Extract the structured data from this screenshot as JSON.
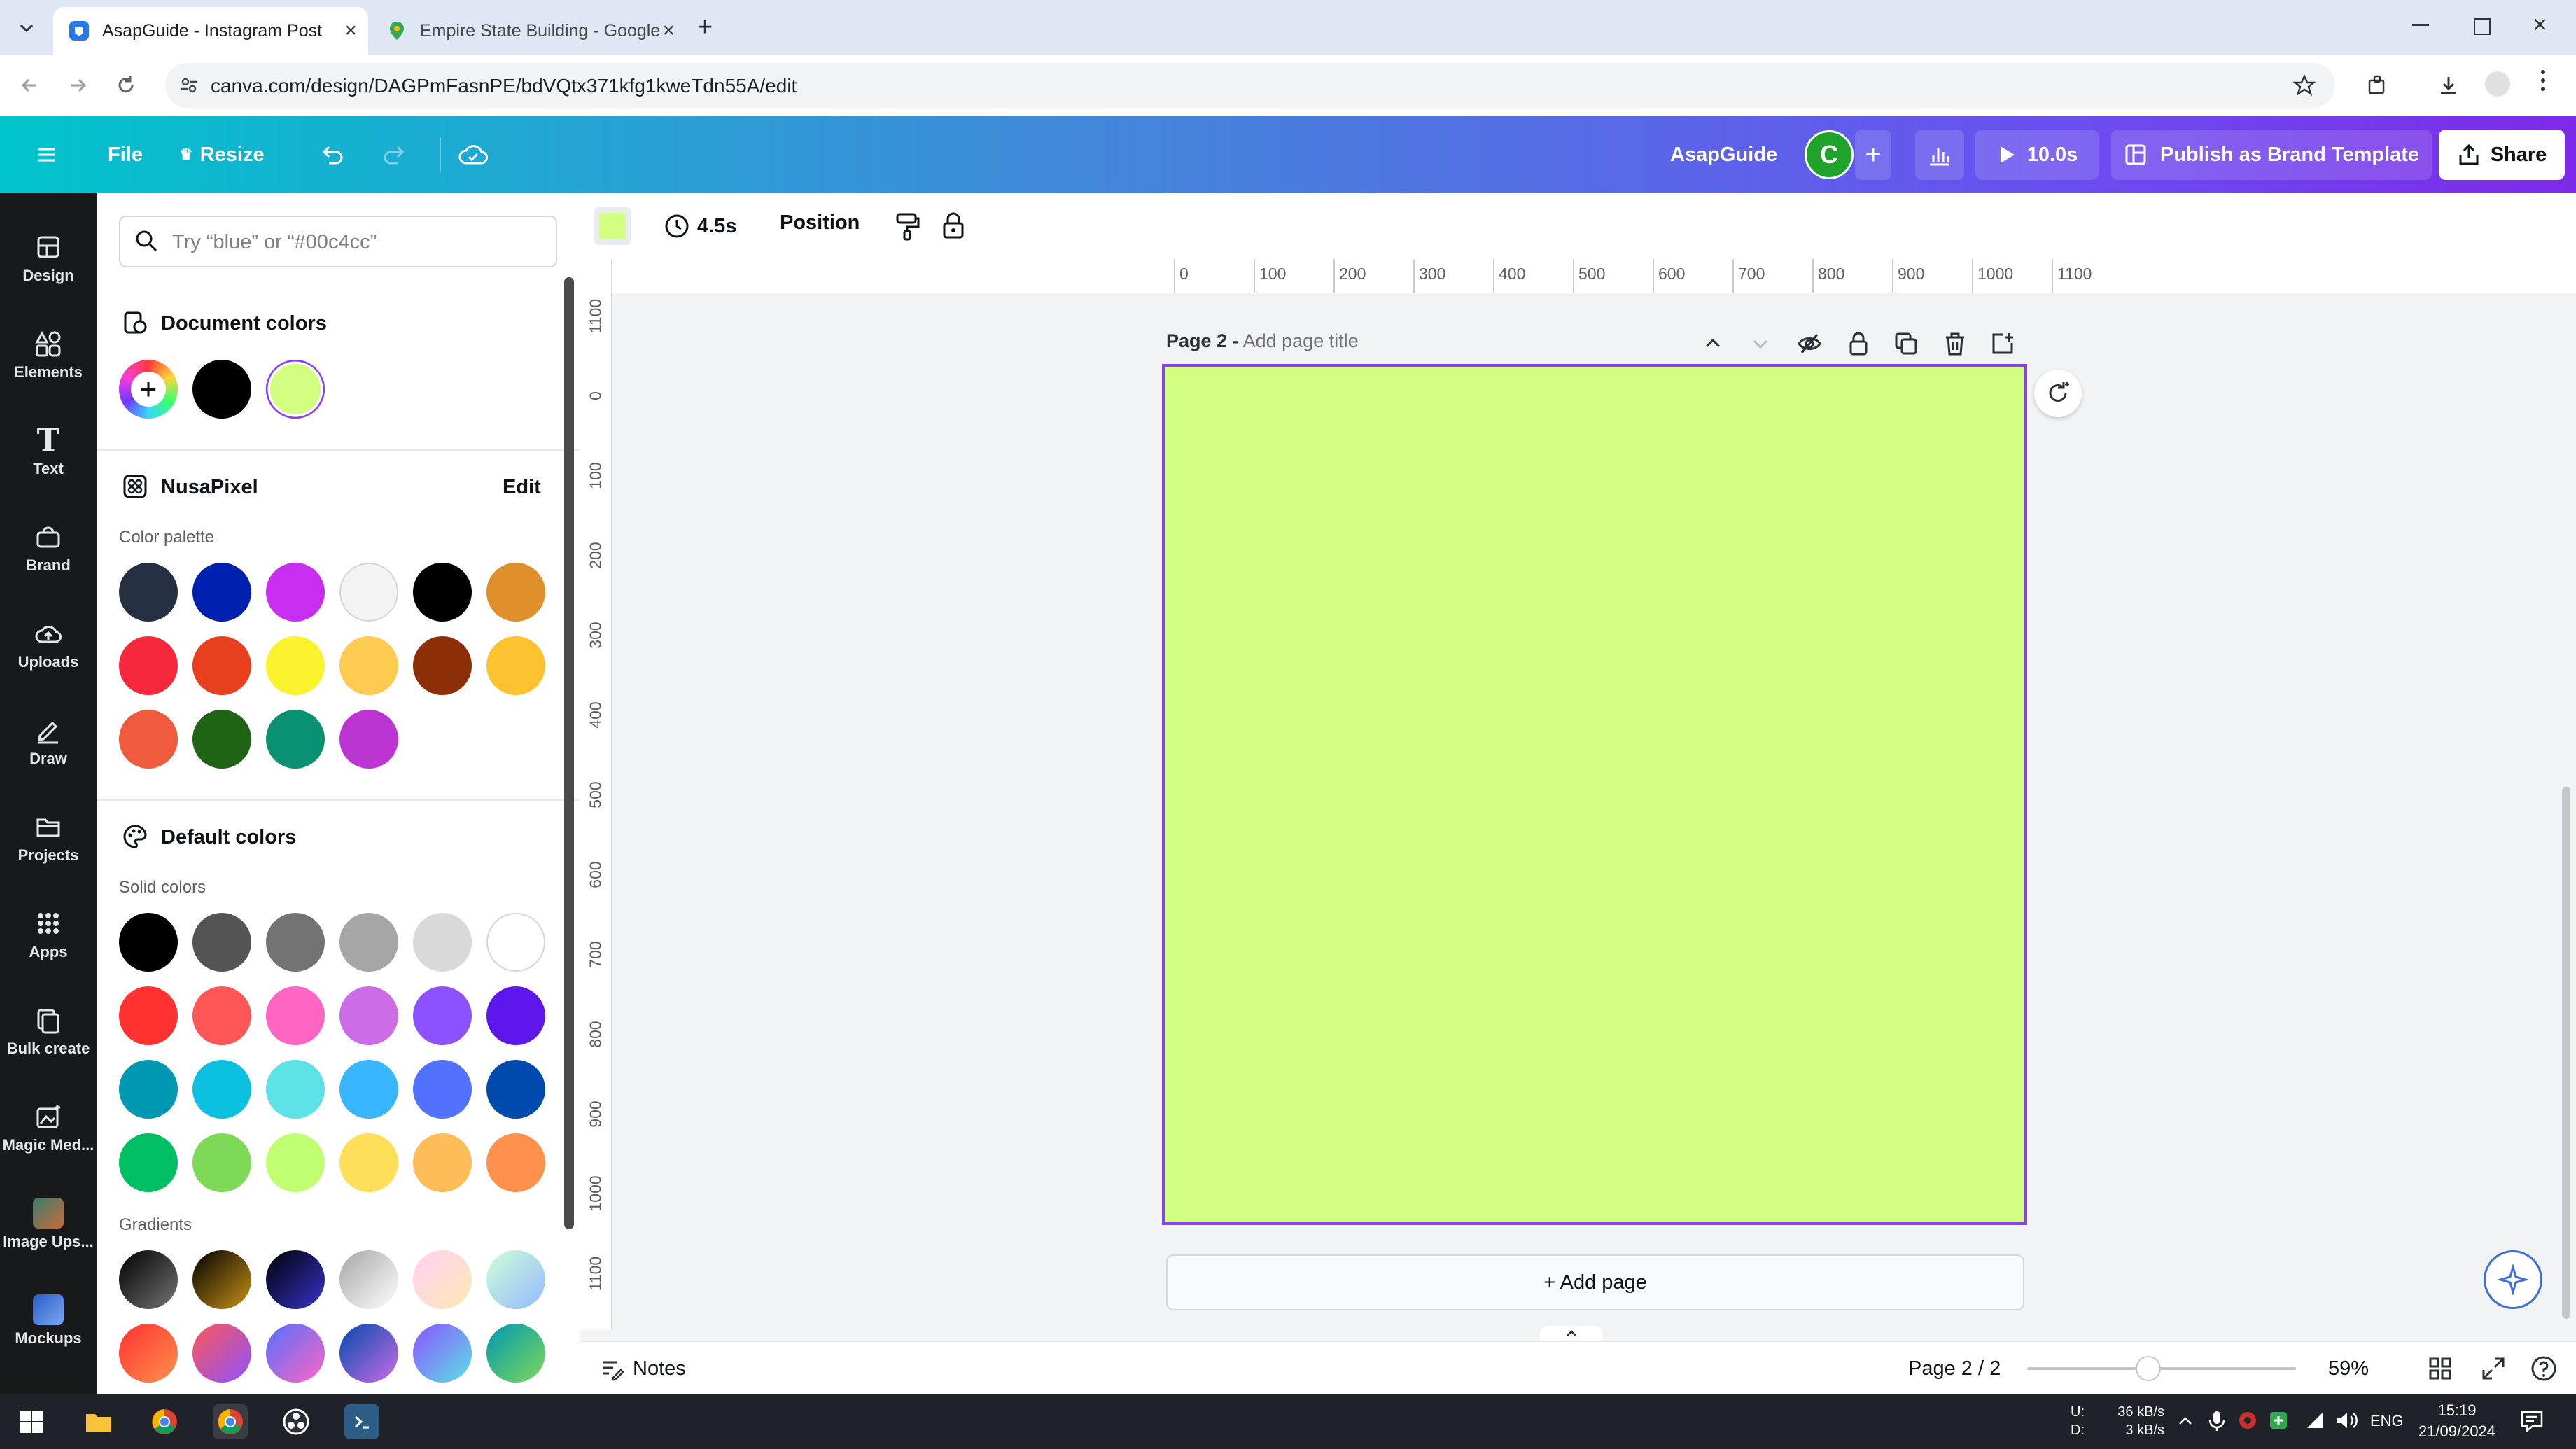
{
  "browser": {
    "tabs": [
      {
        "title": "AsapGuide - Instagram Post",
        "active": true
      },
      {
        "title": "Empire State Building - Google",
        "active": false
      }
    ],
    "url": "canva.com/design/DAGPmFasnPE/bdVQtx371kfg1kweTdn55A/edit"
  },
  "header": {
    "file_label": "File",
    "resize_label": "Resize",
    "team_name": "AsapGuide",
    "avatar_letter": "C",
    "play_label": "10.0s",
    "publish_label": "Publish as Brand Template",
    "share_label": "Share"
  },
  "rail": [
    {
      "label": "Design",
      "icon": "design-icon"
    },
    {
      "label": "Elements",
      "icon": "elements-icon"
    },
    {
      "label": "Text",
      "icon": "text-icon"
    },
    {
      "label": "Brand",
      "icon": "brand-icon"
    },
    {
      "label": "Uploads",
      "icon": "uploads-icon"
    },
    {
      "label": "Draw",
      "icon": "draw-icon"
    },
    {
      "label": "Projects",
      "icon": "projects-icon"
    },
    {
      "label": "Apps",
      "icon": "apps-icon"
    },
    {
      "label": "Bulk create",
      "icon": "bulk-create-icon"
    },
    {
      "label": "Magic Med...",
      "icon": "magic-media-icon"
    },
    {
      "label": "Image Ups...",
      "icon": "image-upscaler-icon"
    },
    {
      "label": "Mockups",
      "icon": "mockups-icon"
    }
  ],
  "panel": {
    "search_placeholder": "Try “blue” or “#00c4cc”",
    "document_colors_title": "Document colors",
    "document_colors": [
      "#000000",
      "#d2fe82"
    ],
    "brand_title": "NusaPixel",
    "brand_edit": "Edit",
    "palette_label": "Color palette",
    "palette": [
      "#253143",
      "#0020b0",
      "#c72ef0",
      "#f3f3f3",
      "#000000",
      "#e0902a",
      "#f5283c",
      "#e8401e",
      "#fbf22e",
      "#fdcb4f",
      "#8c2e08",
      "#fdc22f",
      "#ef5b3c",
      "#1e6414",
      "#0a9173",
      "#bc35d3"
    ],
    "default_title": "Default colors",
    "solid_label": "Solid colors",
    "solid": [
      "#000000",
      "#545454",
      "#737373",
      "#a6a6a6",
      "#d9d9d9",
      "#ffffff",
      "#ff3131",
      "#ff5757",
      "#ff66c4",
      "#cb6ce6",
      "#8c52ff",
      "#5e17eb",
      "#0097b2",
      "#0cc0df",
      "#5ce1e6",
      "#38b6ff",
      "#5271ff",
      "#004aad",
      "#00bf63",
      "#7ed957",
      "#c1ff72",
      "#ffde59",
      "#ffbd59",
      "#ff914d"
    ],
    "gradients_label": "Gradients"
  },
  "toolbar": {
    "fill_color": "#d2fe82",
    "duration": "4.5s",
    "position_label": "Position"
  },
  "ruler": {
    "horizontal": [
      "0",
      "100",
      "200",
      "300",
      "400",
      "500",
      "600",
      "700",
      "800",
      "900",
      "1000",
      "1100"
    ],
    "vertical": [
      "1100",
      "0",
      "100",
      "200",
      "300",
      "400",
      "500",
      "600",
      "700",
      "800",
      "900",
      "1000",
      "1100"
    ]
  },
  "page": {
    "label": "Page 2 -",
    "title_placeholder": "Add page title",
    "background": "#d2fe82"
  },
  "add_page_label": "+ Add page",
  "footer": {
    "notes_label": "Notes",
    "page_indicator": "Page 2 / 2",
    "zoom": "59%",
    "zoom_level": 0.45
  },
  "taskbar": {
    "net_up": "36 kB/s",
    "net_down": "3 kB/s",
    "net_u_label": "U:",
    "net_d_label": "D:",
    "lang": "ENG",
    "time": "15:19",
    "date": "21/09/2024"
  }
}
